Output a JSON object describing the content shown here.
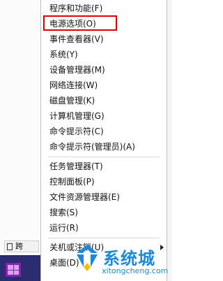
{
  "menu": {
    "items": [
      {
        "label": "程序和功能(F)"
      },
      {
        "label": "电源选项(O)"
      },
      {
        "label": "事件查看器(V)"
      },
      {
        "label": "系统(Y)"
      },
      {
        "label": "设备管理器(M)"
      },
      {
        "label": "网络连接(W)"
      },
      {
        "label": "磁盘管理(K)"
      },
      {
        "label": "计算机管理(G)"
      },
      {
        "label": "命令提示符(C)"
      },
      {
        "label": "命令提示符(管理员)(A)"
      },
      {
        "label": "任务管理器(T)"
      },
      {
        "label": "控制面板(P)"
      },
      {
        "label": "文件资源管理器(E)"
      },
      {
        "label": "搜索(S)"
      },
      {
        "label": "运行(R)"
      },
      {
        "label": "关机或注销(U)"
      },
      {
        "label": "桌面(D)"
      }
    ]
  },
  "taskbar": {
    "app_label": "跨"
  },
  "watermark": {
    "title": "系统城",
    "url": "xitongcheng.com"
  },
  "colors": {
    "highlight_border": "#e00000",
    "watermark_blue": "#1e88d8",
    "start_tile": "#8a1fb5",
    "taskbar": "#2b2b6f"
  },
  "icons": {
    "start": "windows-start-icon",
    "submenu": "chevron-right-icon",
    "doc": "document-icon"
  }
}
